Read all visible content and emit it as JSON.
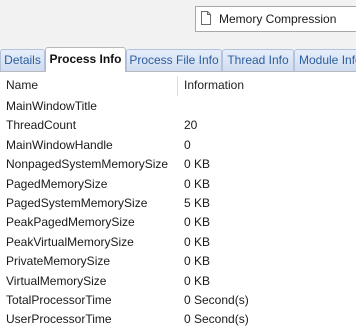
{
  "process_selector": {
    "name": "Memory Compression",
    "icon": "document-icon"
  },
  "tabs": [
    {
      "label": "Details"
    },
    {
      "label": "Process Info",
      "active": true
    },
    {
      "label": "Process File Info"
    },
    {
      "label": "Thread Info"
    },
    {
      "label": "Module Info"
    }
  ],
  "table": {
    "columns": [
      "Name",
      "Information"
    ],
    "rows": [
      {
        "name": "MainWindowTitle",
        "value": ""
      },
      {
        "name": "ThreadCount",
        "value": "20"
      },
      {
        "name": "MainWindowHandle",
        "value": "0"
      },
      {
        "name": "NonpagedSystemMemorySize",
        "value": "0 KB"
      },
      {
        "name": "PagedMemorySize",
        "value": "0 KB"
      },
      {
        "name": "PagedSystemMemorySize",
        "value": "5 KB"
      },
      {
        "name": "PeakPagedMemorySize",
        "value": "0 KB"
      },
      {
        "name": "PeakVirtualMemorySize",
        "value": "0 KB"
      },
      {
        "name": "PrivateMemorySize",
        "value": "0 KB"
      },
      {
        "name": "VirtualMemorySize",
        "value": "0 KB"
      },
      {
        "name": "TotalProcessorTime",
        "value": "0 Second(s)"
      },
      {
        "name": "UserProcessorTime",
        "value": "0 Second(s)"
      }
    ]
  }
}
